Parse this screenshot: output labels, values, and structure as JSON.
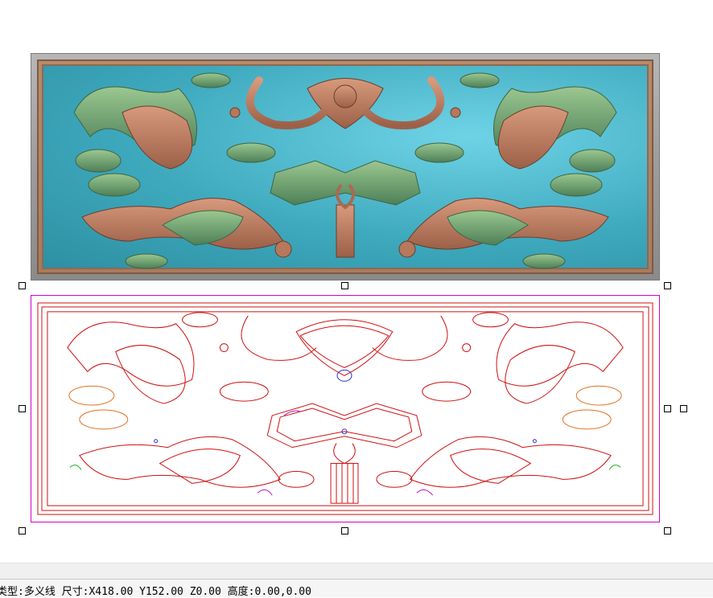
{
  "status": {
    "text": "类型:多义线 尺寸:X418.00 Y152.00 Z0.00 高度:0.00,0.00"
  },
  "colors": {
    "relief_bg": "#3ea9bd",
    "relief_motif": "#c07f63",
    "relief_leaf": "#5e9c6c",
    "vector_stroke": "#d01010",
    "selection_box": "#d000d0",
    "accent_orange": "#e07020",
    "accent_green": "#20b020",
    "accent_blue": "#3030d0"
  },
  "icons": {
    "relief": "carved-bat-relief-preview",
    "vector": "polyline-vector-drawing",
    "handles": "selection-handle"
  }
}
